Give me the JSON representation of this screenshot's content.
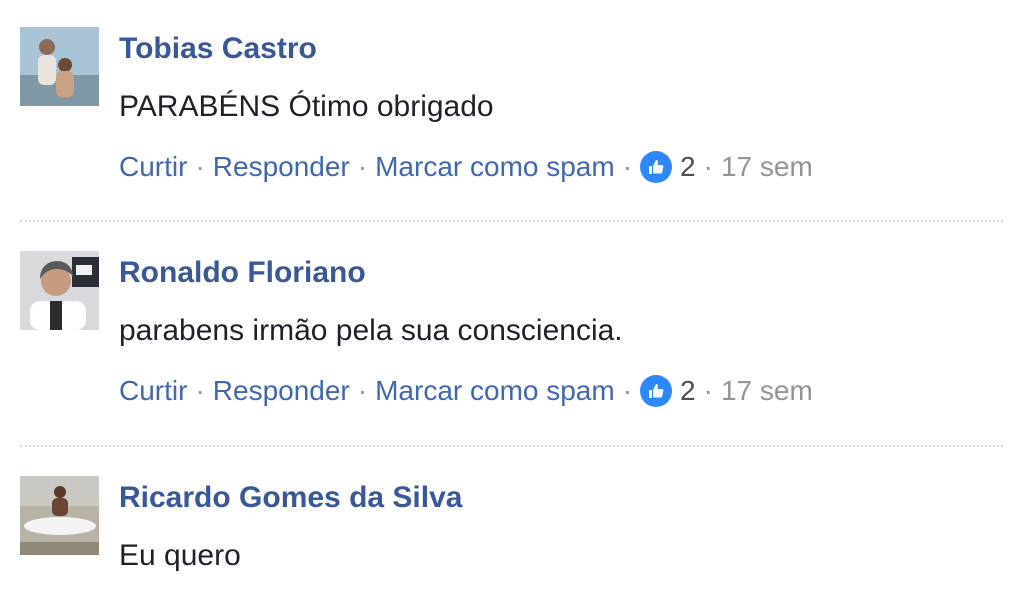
{
  "comments": [
    {
      "author": "Tobias Castro",
      "text": "PARABÉNS Ótimo obrigado",
      "actions": {
        "like": "Curtir",
        "reply": "Responder",
        "spam": "Marcar como spam"
      },
      "likes": "2",
      "time": "17 sem"
    },
    {
      "author": "Ronaldo Floriano",
      "text": "parabens irmão pela sua consciencia.",
      "actions": {
        "like": "Curtir",
        "reply": "Responder",
        "spam": "Marcar como spam"
      },
      "likes": "2",
      "time": "17 sem"
    },
    {
      "author": "Ricardo Gomes da Silva",
      "text": "Eu quero"
    }
  ],
  "separator": "·",
  "icons": {
    "like": "thumbs-up-icon"
  },
  "colors": {
    "author": "#385898",
    "link": "#4267b2",
    "meta": "#90949c",
    "like_badge": "#2d88ff"
  }
}
